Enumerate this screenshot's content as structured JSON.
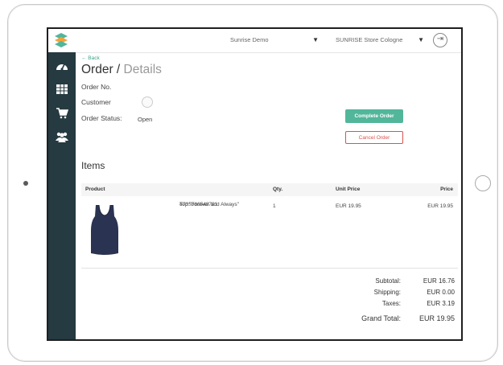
{
  "topbar": {
    "project_select": "Sunrise Demo",
    "store_select": "SUNRISE Store Cologne"
  },
  "sidebar": {
    "items": [
      {
        "icon": "dashboard-icon"
      },
      {
        "icon": "table-icon"
      },
      {
        "icon": "cart-icon"
      },
      {
        "icon": "users-icon"
      }
    ]
  },
  "header": {
    "back": "← Back",
    "title_main": "Order",
    "title_sep": " / ",
    "title_sub": "Details"
  },
  "order": {
    "order_no_label": "Order No.",
    "customer_label": "Customer",
    "status_label": "Order Status:",
    "status_value": "Open"
  },
  "actions": {
    "complete": "Complete Order",
    "cancel": "Cancel Order"
  },
  "items": {
    "heading": "Items",
    "columns": {
      "product": "Product",
      "qty": "Qty.",
      "unit_price": "Unit Price",
      "price": "Price"
    },
    "rows": [
      {
        "sku": "6735366548791",
        "name": "Top \"Forever and Always\"",
        "qty": "1",
        "unit_price": "EUR 19.95",
        "price": "EUR 19.95"
      }
    ]
  },
  "totals": {
    "subtotal_label": "Subtotal:",
    "subtotal_value": "EUR 16.76",
    "shipping_label": "Shipping:",
    "shipping_value": "EUR 0.00",
    "taxes_label": "Taxes:",
    "taxes_value": "EUR 3.19",
    "grand_label": "Grand Total:",
    "grand_value": "EUR 19.95"
  },
  "colors": {
    "sidebar": "#253a41",
    "accent": "#52b69a",
    "danger": "#d9534f"
  }
}
